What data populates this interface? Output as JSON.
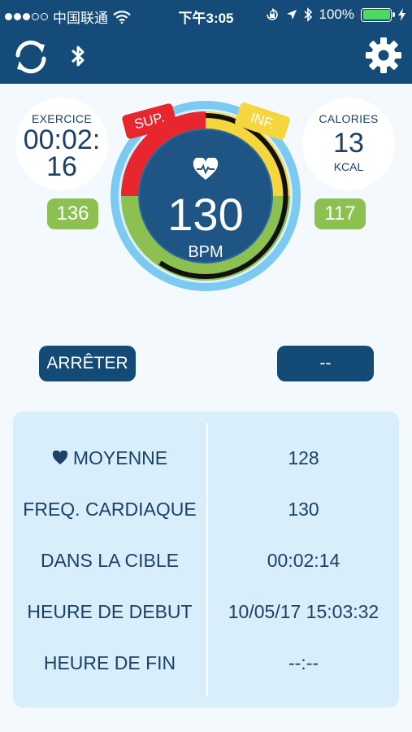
{
  "status_bar": {
    "carrier": "中国联通",
    "time": "下午3:05",
    "battery": "100%",
    "icons": [
      "signal-dots",
      "wifi-icon",
      "lock-rotation-icon",
      "location-arrow-icon",
      "bluetooth-icon",
      "battery-icon",
      "charging-icon"
    ]
  },
  "app_bar": {
    "icons": [
      "sync-icon",
      "bluetooth-icon",
      "settings-gear-icon"
    ]
  },
  "exercise": {
    "label": "EXERCICE",
    "time_line1": "00:02:",
    "time_line2": "16"
  },
  "calories": {
    "label": "CALORIES",
    "value": "13",
    "unit": "KCAL"
  },
  "zones": {
    "upper_limit": "136",
    "lower_limit": "117"
  },
  "dial": {
    "bpm": "130",
    "unit": "BPM",
    "sup_flag": "SUP.",
    "inf_flag": "INF.",
    "colors": {
      "above": "#e8262d",
      "target": "#8cc152",
      "below": "#f5d63c",
      "ring": "#7ccaf2",
      "center": "#1e5584"
    }
  },
  "buttons": {
    "stop": "ARRÊTER",
    "secondary": "--"
  },
  "summary": [
    {
      "label": "MOYENNE",
      "value": "128",
      "icon": "heart-icon"
    },
    {
      "label": "FREQ. CARDIAQUE",
      "value": "130"
    },
    {
      "label": "DANS LA CIBLE",
      "value": "00:02:14"
    },
    {
      "label": "HEURE DE DEBUT",
      "value": "10/05/17 15:03:32"
    },
    {
      "label": "HEURE DE FIN",
      "value": "--:--"
    }
  ]
}
